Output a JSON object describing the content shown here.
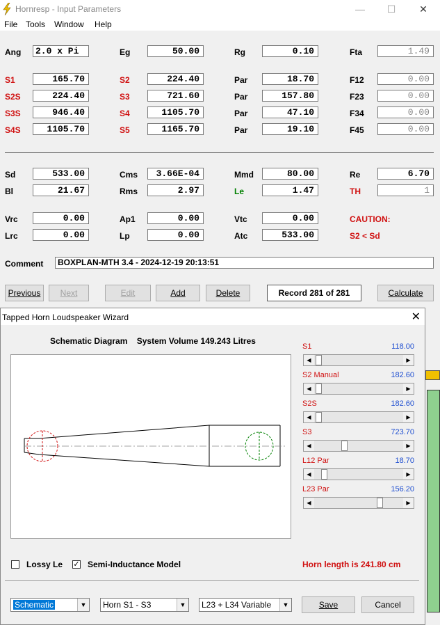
{
  "main": {
    "title": "Hornresp - Input Parameters",
    "window_controls": {
      "minimize": "—",
      "maximize": "☐",
      "close": "✕"
    },
    "menu": [
      "File",
      "Tools",
      "Window",
      "Help"
    ],
    "params": {
      "ang": {
        "label": "Ang",
        "value": "2.0 x Pi"
      },
      "eg": {
        "label": "Eg",
        "value": "50.00"
      },
      "rg": {
        "label": "Rg",
        "value": "0.10"
      },
      "fta": {
        "label": "Fta",
        "value": "1.49"
      },
      "s1": {
        "label": "S1",
        "value": "165.70"
      },
      "s2": {
        "label": "S2",
        "value": "224.40"
      },
      "par1": {
        "label": "Par",
        "value": "18.70"
      },
      "f12": {
        "label": "F12",
        "value": "0.00"
      },
      "s2s": {
        "label": "S2S",
        "value": "224.40"
      },
      "s3": {
        "label": "S3",
        "value": "721.60"
      },
      "par2": {
        "label": "Par",
        "value": "157.80"
      },
      "f23": {
        "label": "F23",
        "value": "0.00"
      },
      "s3s": {
        "label": "S3S",
        "value": "946.40"
      },
      "s4": {
        "label": "S4",
        "value": "1105.70"
      },
      "par3": {
        "label": "Par",
        "value": "47.10"
      },
      "f34": {
        "label": "F34",
        "value": "0.00"
      },
      "s4s": {
        "label": "S4S",
        "value": "1105.70"
      },
      "s5": {
        "label": "S5",
        "value": "1165.70"
      },
      "par4": {
        "label": "Par",
        "value": "19.10"
      },
      "f45": {
        "label": "F45",
        "value": "0.00"
      },
      "sd": {
        "label": "Sd",
        "value": "533.00"
      },
      "cms": {
        "label": "Cms",
        "value": "3.66E-04"
      },
      "mmd": {
        "label": "Mmd",
        "value": "80.00"
      },
      "re": {
        "label": "Re",
        "value": "6.70"
      },
      "bl": {
        "label": "Bl",
        "value": "21.67"
      },
      "rms": {
        "label": "Rms",
        "value": "2.97"
      },
      "le": {
        "label": "Le",
        "value": "1.47"
      },
      "th": {
        "label": "TH",
        "value": "1"
      },
      "vrc": {
        "label": "Vrc",
        "value": "0.00"
      },
      "ap1": {
        "label": "Ap1",
        "value": "0.00"
      },
      "vtc": {
        "label": "Vtc",
        "value": "0.00"
      },
      "lrc": {
        "label": "Lrc",
        "value": "0.00"
      },
      "lp": {
        "label": "Lp",
        "value": "0.00"
      },
      "atc": {
        "label": "Atc",
        "value": "533.00"
      }
    },
    "caution": {
      "title": "CAUTION:",
      "message": "S2 < Sd"
    },
    "comment": {
      "label": "Comment",
      "value": "BOXPLAN-MTH 3.4 - 2024-12-19 20:13:51"
    },
    "buttons": {
      "previous": "Previous",
      "next": "Next",
      "edit": "Edit",
      "add": "Add",
      "delete": "Delete",
      "record": "Record 281 of 281",
      "calculate": "Calculate"
    }
  },
  "wizard": {
    "title": "Tapped Horn Loudspeaker Wizard",
    "close": "✕",
    "header": "Schematic Diagram    System Volume 149.243 Litres",
    "sliders": [
      {
        "label": "S1",
        "value": "118.00",
        "position": 0.02
      },
      {
        "label": "S2  Manual",
        "value": "182.60",
        "position": 0.02
      },
      {
        "label": "S2S",
        "value": "182.60",
        "position": 0.02
      },
      {
        "label": "S3",
        "value": "723.70",
        "position": 0.33
      },
      {
        "label": "L12  Par",
        "value": "18.70",
        "position": 0.08
      },
      {
        "label": "L23  Par",
        "value": "156.20",
        "position": 0.76
      }
    ],
    "lossy_le": {
      "label": "Lossy Le",
      "checked": false
    },
    "semi_inductance": {
      "label": "Semi-Inductance Model",
      "checked": true,
      "mark": "✓"
    },
    "horn_length": "Horn length is 241.80 cm",
    "combo_view": "Schematic",
    "combo_horn": "Horn S1 - S3",
    "combo_mode": "L23 + L34 Variable",
    "save": "Save",
    "cancel": "Cancel"
  },
  "colors": {
    "label_red": "#d01010",
    "label_green": "#008000",
    "value_blue": "#1f4fd1",
    "schematic_red": "#d01010",
    "schematic_green": "#008000"
  }
}
